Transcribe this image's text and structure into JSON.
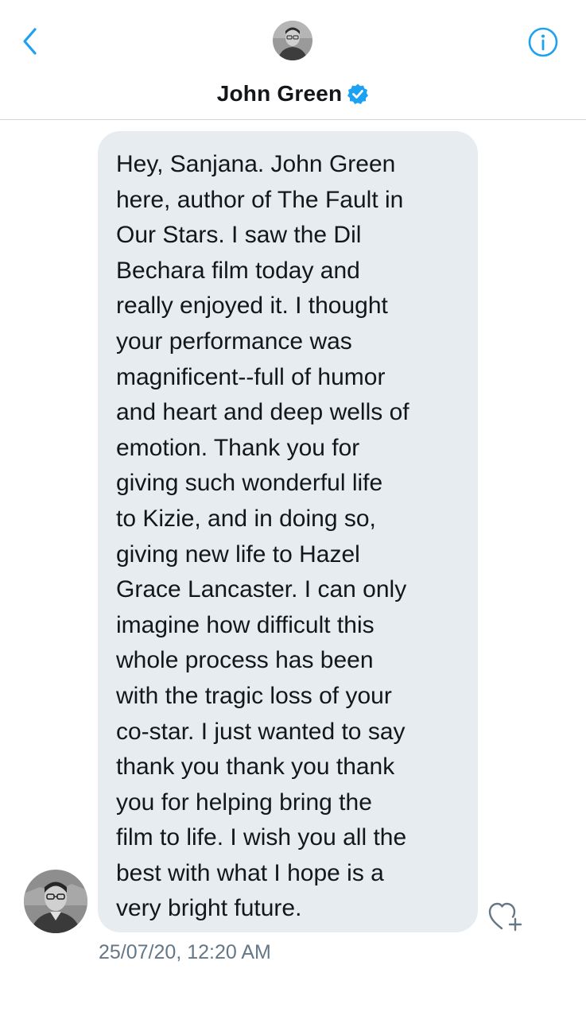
{
  "header": {
    "back_icon": "chevron-left-icon",
    "info_icon": "info-circle-icon",
    "avatar_icon": "profile-photo",
    "name": "John Green",
    "verified_icon": "verified-badge-icon",
    "accent_color": "#1da1f2"
  },
  "message": {
    "text": "Hey, Sanjana. John Green\nhere, author of The Fault in\nOur Stars. I saw the Dil\nBechara film today and\nreally enjoyed it. I thought\nyour performance was\nmagnificent--full of humor\nand heart and deep wells of\nemotion. Thank you for\ngiving such wonderful life\nto Kizie, and in doing so,\ngiving new life to Hazel\nGrace Lancaster. I can only\nimagine how difficult this\nwhole process has been\nwith the tragic loss of your\nco-star. I just wanted to say\nthank you thank you thank\nyou for helping bring the\nfilm to life. I wish you all the\nbest with what I hope is a\nvery bright future.",
    "timestamp": "25/07/20, 12:20 AM",
    "like_icon": "heart-add-icon",
    "bubble_color": "#e6ecf0"
  }
}
